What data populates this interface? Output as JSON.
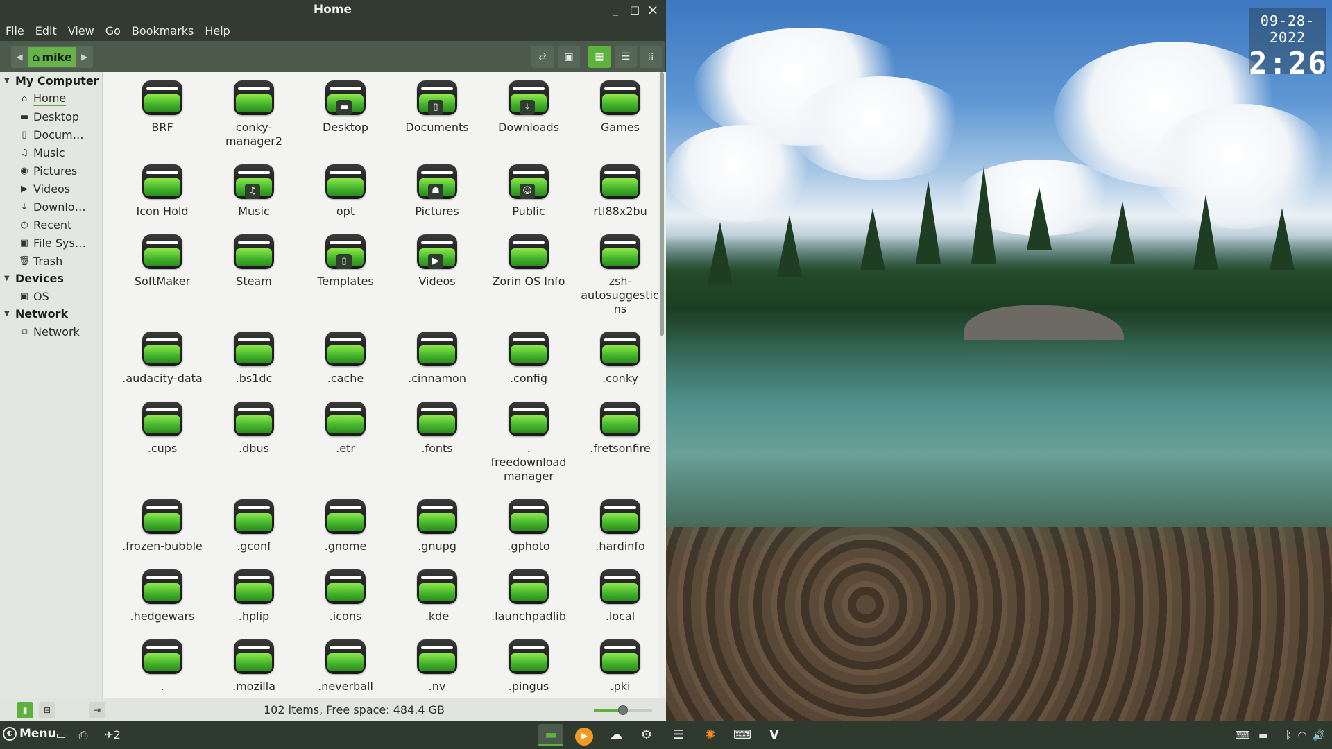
{
  "window": {
    "title": "Home",
    "controls": {
      "minimize": "_",
      "maximize": "□",
      "close": "×"
    }
  },
  "menubar": [
    "File",
    "Edit",
    "View",
    "Go",
    "Bookmarks",
    "Help"
  ],
  "toolbar": {
    "crumb": "mike",
    "crumb_icon": "home-icon",
    "buttons": [
      "toggle-location-icon",
      "preview-icon",
      "icon-view-icon",
      "list-view-icon",
      "compact-view-icon"
    ],
    "active_view": "icon-view"
  },
  "sidebar": {
    "sections": [
      {
        "label": "My Computer",
        "items": [
          {
            "label": "Home",
            "icon": "home-icon",
            "glyph": "⌂",
            "active": true
          },
          {
            "label": "Desktop",
            "icon": "folder-icon",
            "glyph": "▬"
          },
          {
            "label": "Docum…",
            "icon": "document-icon",
            "glyph": "▯"
          },
          {
            "label": "Music",
            "icon": "music-icon",
            "glyph": "♫"
          },
          {
            "label": "Pictures",
            "icon": "camera-icon",
            "glyph": "◉"
          },
          {
            "label": "Videos",
            "icon": "video-icon",
            "glyph": "▶"
          },
          {
            "label": "Downlo…",
            "icon": "download-icon",
            "glyph": "↓"
          },
          {
            "label": "Recent",
            "icon": "clock-icon",
            "glyph": "◷"
          },
          {
            "label": "File Sys…",
            "icon": "drive-icon",
            "glyph": "▣"
          },
          {
            "label": "Trash",
            "icon": "trash-icon",
            "glyph": "🗑"
          }
        ]
      },
      {
        "label": "Devices",
        "items": [
          {
            "label": "OS",
            "icon": "drive-icon",
            "glyph": "▣"
          }
        ]
      },
      {
        "label": "Network",
        "items": [
          {
            "label": "Network",
            "icon": "network-icon",
            "glyph": "⧉"
          }
        ]
      }
    ]
  },
  "files": [
    {
      "name": "BRF"
    },
    {
      "name": "conky-\nmanager2"
    },
    {
      "name": "Desktop",
      "emblem": "▬"
    },
    {
      "name": "Documents",
      "emblem": "▯"
    },
    {
      "name": "Downloads",
      "emblem": "⤓"
    },
    {
      "name": "Games"
    },
    {
      "name": "Icon Hold"
    },
    {
      "name": "Music",
      "emblem": "♫"
    },
    {
      "name": "opt"
    },
    {
      "name": "Pictures",
      "emblem": "☗"
    },
    {
      "name": "Public",
      "emblem": "☺"
    },
    {
      "name": "rtl88x2bu"
    },
    {
      "name": "SoftMaker"
    },
    {
      "name": "Steam"
    },
    {
      "name": "Templates",
      "emblem": "▯"
    },
    {
      "name": "Videos",
      "emblem": "▶"
    },
    {
      "name": "Zorin OS Info"
    },
    {
      "name": "zsh-\nautosuggestio\nns"
    },
    {
      "name": ".audacity-data"
    },
    {
      "name": ".bs1dc"
    },
    {
      "name": ".cache"
    },
    {
      "name": ".cinnamon"
    },
    {
      "name": ".config"
    },
    {
      "name": ".conky"
    },
    {
      "name": ".cups"
    },
    {
      "name": ".dbus"
    },
    {
      "name": ".etr"
    },
    {
      "name": ".fonts"
    },
    {
      "name": ".\nfreedownload\nmanager"
    },
    {
      "name": ".fretsonfire"
    },
    {
      "name": ".frozen-bubble"
    },
    {
      "name": ".gconf"
    },
    {
      "name": ".gnome"
    },
    {
      "name": ".gnupg"
    },
    {
      "name": ".gphoto"
    },
    {
      "name": ".hardinfo"
    },
    {
      "name": ".hedgewars"
    },
    {
      "name": ".hplip"
    },
    {
      "name": ".icons"
    },
    {
      "name": ".kde"
    },
    {
      "name": ".launchpadlib"
    },
    {
      "name": ".local"
    },
    {
      "name": "."
    },
    {
      "name": ".mozilla"
    },
    {
      "name": ".neverball"
    },
    {
      "name": ".nv"
    },
    {
      "name": ".pingus"
    },
    {
      "name": ".pki"
    }
  ],
  "statusbar": {
    "info": "102 items, Free space: 484.4 GB",
    "zoom_fraction": 0.5
  },
  "conky": {
    "date": "09-28-2022",
    "time": "2:26"
  },
  "taskbar": {
    "menu_label": "Menu",
    "update_count": "2"
  },
  "colors": {
    "accent": "#5cb23d",
    "panel": "#2f3a2f",
    "titlebar": "#323a32"
  }
}
